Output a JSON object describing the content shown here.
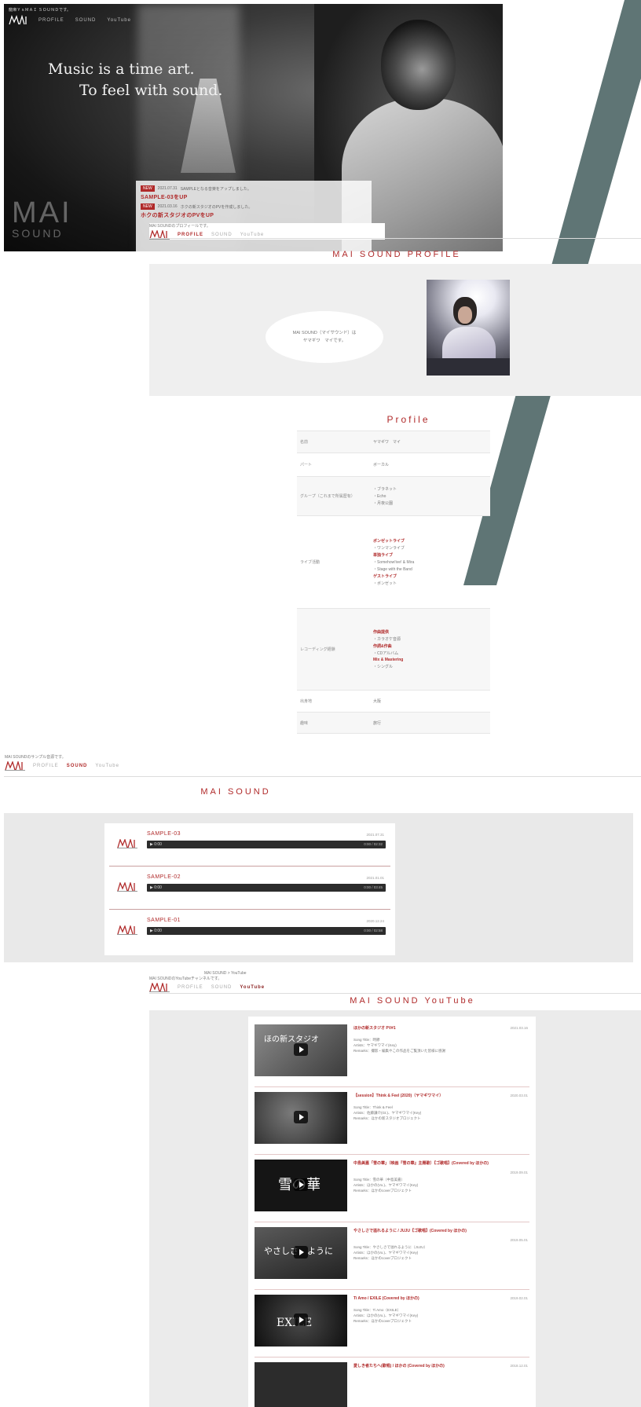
{
  "hero": {
    "top_note": "龍麻ＹｓＭＡＩ ＳＯＵＮＤです。",
    "nav": [
      "PROFILE",
      "SOUND",
      "YouTube"
    ],
    "catch_line1": "Music is a time art.",
    "catch_line2": "To feel with sound.",
    "logo_mai": "MAI",
    "logo_sound": "SOUND",
    "news": [
      {
        "tag": "NEW",
        "date": "2021.07.31",
        "text": "SAMPLEとなる音楽をアップしました。",
        "title": "SAMPLE-03をUP"
      },
      {
        "tag": "NEW",
        "date": "2021.03.16",
        "text": "ホクの新スタジオのPVを作成しました。",
        "title": "ホクの新スタジオのPVをUP"
      }
    ]
  },
  "profile": {
    "header_note": "MAI SOUNDのプロフィールです。",
    "nav": [
      "PROFILE",
      "SOUND",
      "YouTube"
    ],
    "section_title": "MAI SOUND PROFILE",
    "bubble_line1": "MAI SOUND（マイサウンド）は",
    "bubble_line2": "ヤマギワ　マイです。",
    "subtitle": "Profile",
    "rows": [
      {
        "key": "名前",
        "values": [
          "ヤマギワ　マイ"
        ]
      },
      {
        "key": "パート",
        "values": [
          "ボーカル"
        ]
      },
      {
        "key": "グループ（これまで所属歴有）",
        "values": [
          "・ブラネット",
          "・Echo",
          "・月夜公園"
        ]
      },
      {
        "key": "ライブ活動",
        "red": [
          "ボンゼットライブ",
          "単独ライブ",
          "ゲストライブ"
        ],
        "values": [
          "・ワンマンライブ",
          "・Somehow!ive! & Mira",
          "・Stage with the Band",
          "・ボンゼット"
        ]
      },
      {
        "key": "レコーディング経験",
        "red": [
          "作曲提供",
          "作詞&作曲",
          "Mix & Mastering"
        ],
        "values": [
          "・カラオケ音源",
          "・CDアルバム",
          "・シングル"
        ]
      },
      {
        "key": "出身地",
        "values": [
          "大阪"
        ]
      },
      {
        "key": "趣味",
        "values": [
          "旅行"
        ]
      }
    ]
  },
  "sound": {
    "header_note": "MAI SOUNDのサンプル音源です。",
    "nav": [
      "PROFILE",
      "SOUND",
      "YouTube"
    ],
    "section_title": "MAI SOUND",
    "tracks": [
      {
        "name": "SAMPLE-03",
        "date": "2021.07.31",
        "play": "▶ 0:00",
        "time": "0:00 / 02:32"
      },
      {
        "name": "SAMPLE-02",
        "date": "2021.01.01",
        "play": "▶ 0:00",
        "time": "0:00 / 03:45"
      },
      {
        "name": "SAMPLE-01",
        "date": "2020.12.24",
        "play": "▶ 0:00",
        "time": "0:00 / 02:58"
      }
    ]
  },
  "youtube": {
    "header_note": "MAI SOUNDのYouTubeチャンネルです。",
    "breadcrumb": "MAI SOUND  >  YouTube",
    "nav": [
      "PROFILE",
      "SOUND",
      "YouTube"
    ],
    "section_title": "MAI SOUND YouTube",
    "videos": [
      {
        "title": "ほかの新スタジオ PV#1",
        "date": "2021.03.16",
        "meta1": "Song Title：時節",
        "meta2": "Artists：ヤマギワマイ(Key)",
        "meta3": "Remarks：撮影・編集やこの作品をご覧頂いた皆様に感謝",
        "thumb_text": "ほの新スタジオ",
        "thumb_bg": "#6b6b6b"
      },
      {
        "title": "【session】Think & Feel (2020)（ヤマギワマイ）",
        "date": "2020.03.01",
        "meta1": "Song Title：Think & Feel",
        "meta2": "Artists：佐藤謙介(Gt.)、ヤマギワマイ(Key)",
        "meta3": "Remarks：ほかの新スタジオプロジェクト",
        "thumb_text": "",
        "thumb_bg": "#3a3a3a"
      },
      {
        "title": "中島美嘉「雪の華」（映画『雪の華』主題歌）【ゴ歌唱】(Covered by ほかの)",
        "date": "2019.09.01",
        "meta1": "Song Title：雪の華（中島美嘉）",
        "meta2": "Artists：ほかの(Vo.)、ヤマギワマイ(Key)",
        "meta3": "Remarks：ほかのcoverプロジェクト",
        "thumb_text": "雪の華",
        "thumb_bg": "#1e1e1e"
      },
      {
        "title": "やさしさで溢れるように / JUJU【ゴ歌唱】(Covered by ほかの)",
        "date": "2019.05.01",
        "meta1": "Song Title：やさしさで溢れるように（JUJU）",
        "meta2": "Artists：ほかの(Vo.)、ヤマギワマイ(Key)",
        "meta3": "Remarks：ほかのcoverプロジェクト",
        "thumb_text": "やさしさ　ように",
        "thumb_bg": "#444444"
      },
      {
        "title": "Ti Amo / EXILE (Covered by ほかの)",
        "date": "2019.02.01",
        "meta1": "Song Title：Ti Amo（EXILE）",
        "meta2": "Artists：ほかの(Vo.)、ヤマギワマイ(Key)",
        "meta3": "Remarks：ほかのcoverプロジェクト",
        "thumb_text": "EXILE",
        "thumb_bg": "#2a2a2a"
      },
      {
        "title": "愛しき者たちへ(歌唱) / ほかの (Covered by ほかの)",
        "date": "2018.12.01",
        "meta1": "",
        "meta2": "",
        "meta3": "",
        "thumb_text": "",
        "thumb_bg": "#333333"
      }
    ]
  },
  "colors": {
    "accent": "#b02a2a",
    "stripe": "#5f7575",
    "band": "#ebebeb"
  }
}
